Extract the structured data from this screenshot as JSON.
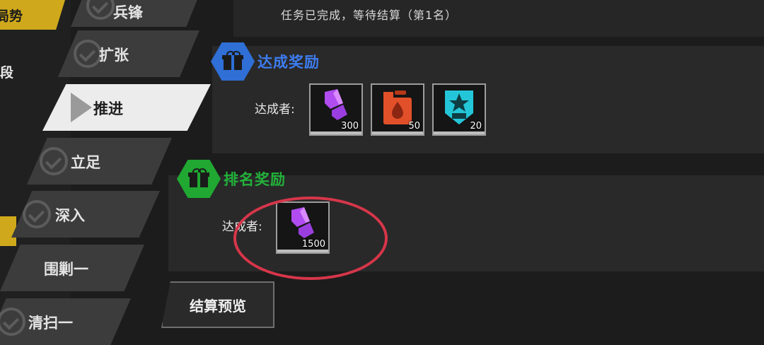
{
  "sidebar": {
    "top_tab_label": "局势",
    "partial_label": "段"
  },
  "stages": [
    {
      "label": "兵锋",
      "status": "completed"
    },
    {
      "label": "扩张",
      "status": "completed"
    },
    {
      "label": "推进",
      "status": "active"
    },
    {
      "label": "立足",
      "status": "completed"
    },
    {
      "label": "深入",
      "status": "completed"
    },
    {
      "label": "围剿一",
      "status": "locked"
    },
    {
      "label": "清扫一",
      "status": "completed"
    }
  ],
  "status_text": "任务已完成，等待结算（第1名）",
  "achievement": {
    "title": "达成奖励",
    "color": "#2f6fd6",
    "row_label": "达成者:",
    "items": [
      {
        "icon": "purple-crystal-icon",
        "count": "300"
      },
      {
        "icon": "red-fuel-can-icon",
        "count": "50"
      },
      {
        "icon": "cyan-star-badge-icon",
        "count": "20"
      }
    ]
  },
  "ranking": {
    "title": "排名奖励",
    "color": "#20a832",
    "row_label": "达成者:",
    "items": [
      {
        "icon": "purple-crystal-icon",
        "count": "1500"
      }
    ]
  },
  "highlight_color": "#d6364a",
  "settle_button_label": "结算预览"
}
